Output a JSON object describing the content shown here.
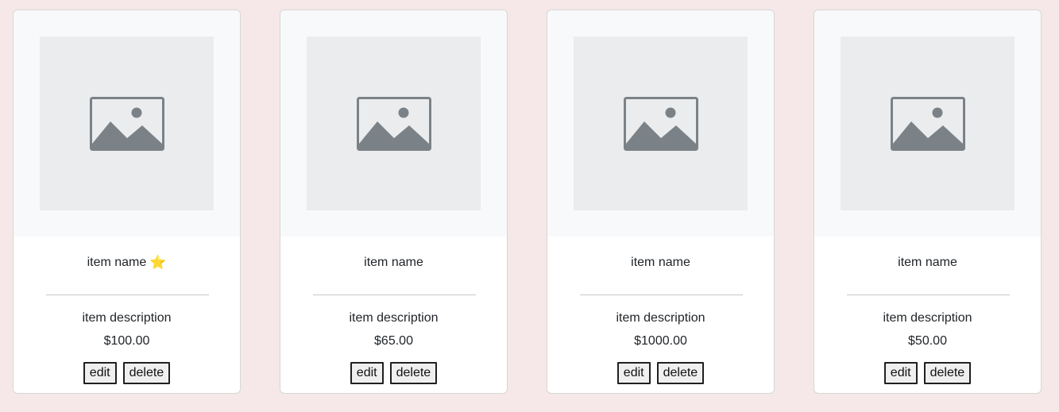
{
  "colors": {
    "page_background": "#f6e8e8",
    "card_background": "#ffffff",
    "image_area_background": "#f8f9fb",
    "placeholder_background": "#ebecee",
    "placeholder_icon": "#7b8287",
    "star": "#f5c518"
  },
  "cards": [
    {
      "name": "item name",
      "favorite": true,
      "description": "item description",
      "price": "$100.00",
      "edit_label": "edit",
      "delete_label": "delete",
      "image_icon": "image-placeholder-icon",
      "favorite_icon": "star-icon"
    },
    {
      "name": "item name",
      "favorite": false,
      "description": "item description",
      "price": "$65.00",
      "edit_label": "edit",
      "delete_label": "delete",
      "image_icon": "image-placeholder-icon"
    },
    {
      "name": "item name",
      "favorite": false,
      "description": "item description",
      "price": "$1000.00",
      "edit_label": "edit",
      "delete_label": "delete",
      "image_icon": "image-placeholder-icon"
    },
    {
      "name": "item name",
      "favorite": false,
      "description": "item description",
      "price": "$50.00",
      "edit_label": "edit",
      "delete_label": "delete",
      "image_icon": "image-placeholder-icon"
    }
  ],
  "star_glyph": "⭐"
}
